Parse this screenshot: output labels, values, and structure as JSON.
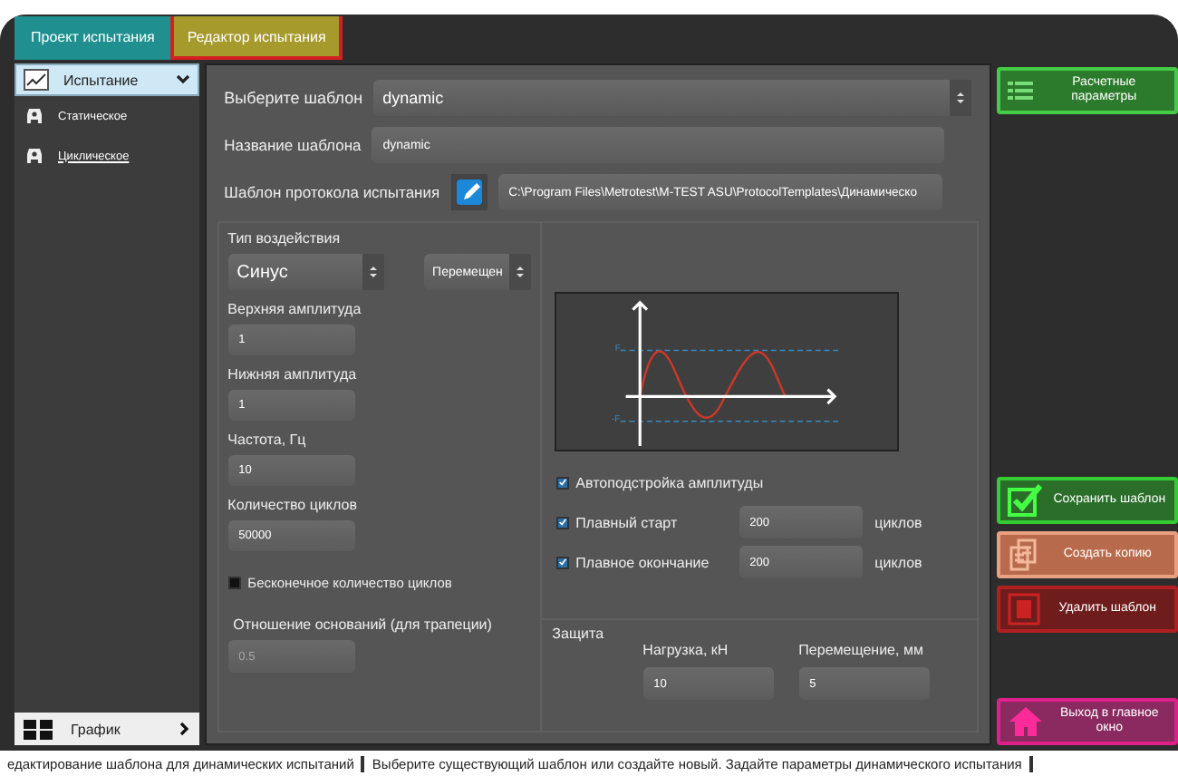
{
  "tabs": [
    {
      "label": "Проект испытания",
      "selected": false
    },
    {
      "label": "Редактор испытания",
      "selected": true
    }
  ],
  "sidebar": {
    "header": {
      "label": "Испытание",
      "expanded": true
    },
    "items": [
      {
        "label": "Статическое",
        "selected": false
      },
      {
        "label": "Циклическое",
        "selected": true
      }
    ],
    "footer": {
      "label": "График"
    }
  },
  "template": {
    "select_label": "Выберите шаблон",
    "select_value": "dynamic",
    "name_label": "Название шаблона",
    "name_value": "dynamic",
    "protocol_label": "Шаблон протокола испытания",
    "protocol_path": "C:\\Program Files\\Metrotest\\M-TEST ASU\\ProtocolTemplates\\Динамическо"
  },
  "impact": {
    "label": "Тип воздействия",
    "type": "Синус",
    "mode": "Перемещен"
  },
  "fields": [
    {
      "label": "Верхняя амплитуда",
      "value": "1"
    },
    {
      "label": "Нижняя амплитуда",
      "value": "1"
    },
    {
      "label": "Частота, Гц",
      "value": "10"
    },
    {
      "label": "Количество циклов",
      "value": "50000"
    }
  ],
  "infinite": {
    "label": "Бесконечное количество циклов",
    "checked": false
  },
  "ratio": {
    "label": "Отношение оснований (для трапеции)",
    "value": "0.5",
    "disabled": true
  },
  "chart": {
    "top_label": "F",
    "bottom_label": "-F"
  },
  "options": [
    {
      "label": "Автоподстройка амплитуды",
      "checked": true,
      "kind": "plain"
    },
    {
      "label": "Плавный старт",
      "checked": true,
      "kind": "cycles",
      "value": "200",
      "unit": "циклов"
    },
    {
      "label": "Плавное окончание",
      "checked": true,
      "kind": "cycles",
      "value": "200",
      "unit": "циклов"
    }
  ],
  "protection": {
    "title": "Защита",
    "fields": [
      {
        "label": "Нагрузка, кН",
        "value": "10"
      },
      {
        "label": "Перемещение, мм",
        "value": "5"
      }
    ]
  },
  "actions": [
    {
      "label": "Расчетные параметры",
      "kind": "calc"
    },
    {
      "label": "Сохранить шаблон",
      "kind": "save"
    },
    {
      "label": "Создать копию",
      "kind": "copy"
    },
    {
      "label": "Удалить шаблон",
      "kind": "delete"
    },
    {
      "label": "Выход в главное окно",
      "kind": "exit"
    }
  ],
  "status_bar": [
    "едактирование шаблона для динамических испытаний",
    "Выберите существующий шаблон или создайте новый. Задайте параметры динамического испытания"
  ]
}
